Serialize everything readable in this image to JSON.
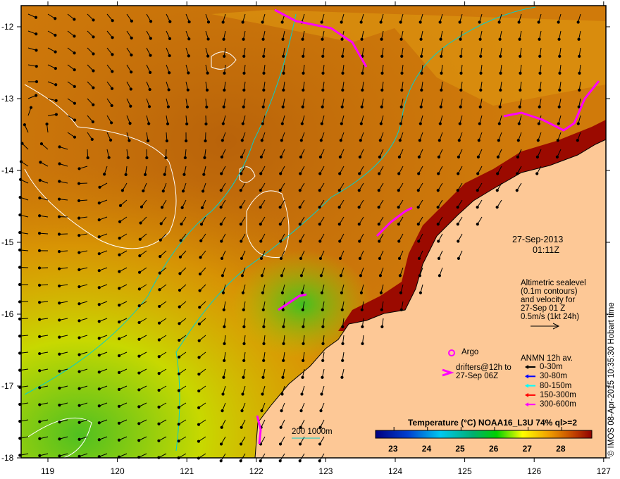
{
  "map": {
    "date": "27-Sep-2013",
    "time": "01:11Z",
    "lon_ticks": [
      "119",
      "120",
      "121",
      "122",
      "123",
      "124",
      "125",
      "126",
      "127"
    ],
    "lat_ticks": [
      "-12",
      "-13",
      "-14",
      "-15",
      "-16",
      "-17",
      "-18"
    ],
    "altimetry_note": [
      "Altimetric sealevel",
      "(0.1m contours)",
      "and velocity for",
      "27-Sep 01 Z",
      "0.5m/s (1kt 24h)"
    ],
    "argo_label": "Argo",
    "drifters_label": [
      "drifters@12h to",
      "27-Sep 06Z"
    ],
    "isobath_label": "200  1000m",
    "anmn": {
      "title": "ANMN 12h av.",
      "items": [
        {
          "label": "0-30m",
          "color": "#000000"
        },
        {
          "label": "30-80m",
          "color": "#0000ff"
        },
        {
          "label": "80-150m",
          "color": "#00ffff"
        },
        {
          "label": "150-300m",
          "color": "#ff0000"
        },
        {
          "label": "300-600m",
          "color": "#ff00ff"
        }
      ]
    },
    "colorbar": {
      "title": "Temperature (°C) NOAA16_L3U 74% ql>=2",
      "ticks": [
        "23",
        "24",
        "25",
        "26",
        "27",
        "28"
      ],
      "range": [
        22.45,
        28.9
      ]
    },
    "credit": "© IMOS 08-Apr-2015 10:35:30 Hobart time",
    "colors": {
      "land": "#fdc896",
      "coast_sst": "#9b0a00",
      "drifter": "#ff00ff",
      "isobath": "#00d0d0",
      "contour": "#ffffff"
    }
  }
}
